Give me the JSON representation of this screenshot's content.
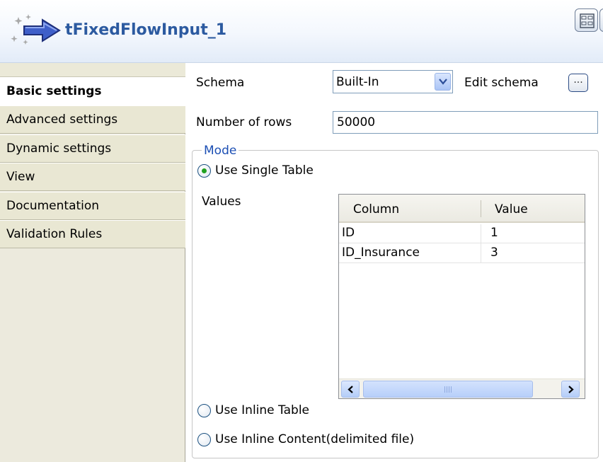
{
  "component": {
    "title": "tFixedFlowInput_1",
    "icon": "fixed-flow-arrow-icon"
  },
  "sidebar": {
    "tabs": [
      {
        "label": "Basic settings",
        "active": true
      },
      {
        "label": "Advanced settings",
        "active": false
      },
      {
        "label": "Dynamic settings",
        "active": false
      },
      {
        "label": "View",
        "active": false
      },
      {
        "label": "Documentation",
        "active": false
      },
      {
        "label": "Validation Rules",
        "active": false
      }
    ]
  },
  "form": {
    "schema_label": "Schema",
    "schema_value": "Built-In",
    "edit_schema_label": "Edit schema",
    "edit_schema_button": "...",
    "rows_label": "Number of rows",
    "rows_value": "50000",
    "mode_legend": "Mode",
    "mode_options": [
      {
        "label": "Use Single Table",
        "selected": true
      },
      {
        "label": "Use Inline Table",
        "selected": false
      },
      {
        "label": "Use Inline Content(delimited file)",
        "selected": false
      }
    ],
    "values_label": "Values"
  },
  "values_table": {
    "headers": [
      "Column",
      "Value"
    ],
    "rows": [
      [
        "ID",
        "1"
      ],
      [
        "ID_Insurance",
        "3"
      ]
    ]
  },
  "colors": {
    "title_blue": "#2c5aa0",
    "legend_blue": "#1c4fb4",
    "radio_selected": "#21a121",
    "sidebar_bg": "#eceadd"
  }
}
